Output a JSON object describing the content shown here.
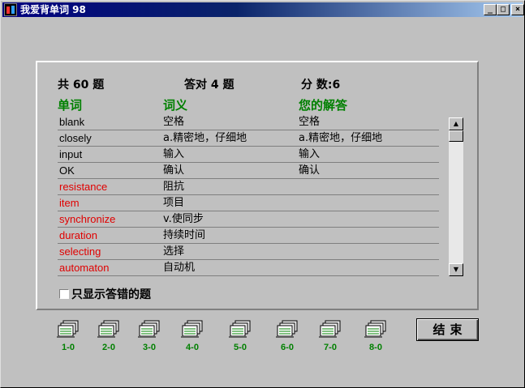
{
  "window": {
    "title": "我爱背单词 98",
    "minimize": "_",
    "maximize": "□",
    "close": "×"
  },
  "summary": {
    "total": "共 60 题",
    "correct": "答对 4 题",
    "score": "分 数:6"
  },
  "columns": {
    "word": "单词",
    "meaning": "词义",
    "answer": "您的解答"
  },
  "rows": [
    {
      "word": "blank",
      "meaning": "空格",
      "answer": "空格",
      "wrong": false
    },
    {
      "word": "closely",
      "meaning": "a.精密地，仔细地",
      "answer": "a.精密地，仔细地",
      "wrong": false
    },
    {
      "word": "input",
      "meaning": "输入",
      "answer": "输入",
      "wrong": false
    },
    {
      "word": "OK",
      "meaning": "确认",
      "answer": "确认",
      "wrong": false
    },
    {
      "word": "resistance",
      "meaning": "阻抗",
      "answer": "",
      "wrong": true
    },
    {
      "word": "item",
      "meaning": "项目",
      "answer": "",
      "wrong": true
    },
    {
      "word": "synchronize",
      "meaning": "v.使同步",
      "answer": "",
      "wrong": true
    },
    {
      "word": "duration",
      "meaning": "持续时间",
      "answer": "",
      "wrong": true
    },
    {
      "word": "selecting",
      "meaning": "选择",
      "answer": "",
      "wrong": true
    },
    {
      "word": "automaton",
      "meaning": "自动机",
      "answer": "",
      "wrong": true
    }
  ],
  "scroll": {
    "up": "▲",
    "down": "▼"
  },
  "filter_checkbox": {
    "label": "只显示答错的题",
    "checked": false
  },
  "groups": [
    "1-0",
    "2-0",
    "3-0",
    "4-0",
    "5-0",
    "6-0",
    "7-0",
    "8-0"
  ],
  "end_button": "结束",
  "colors": {
    "wrong": "#e00000",
    "header": "#008000",
    "group_label": "#008000"
  }
}
